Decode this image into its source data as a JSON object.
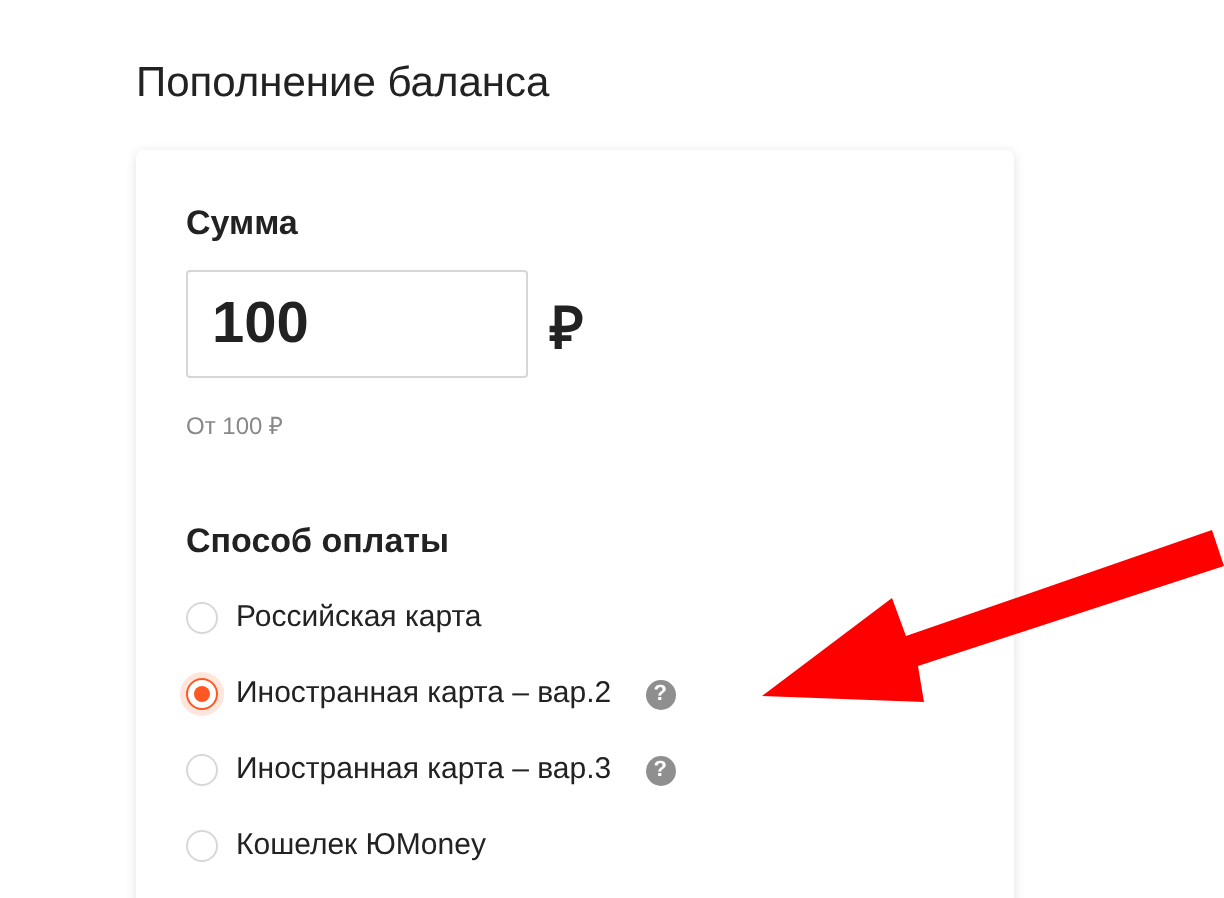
{
  "title": "Пополнение баланса",
  "amount": {
    "label": "Сумма",
    "value": "100",
    "currency": "₽",
    "hint": "От 100 ₽"
  },
  "payment": {
    "label": "Способ оплаты",
    "options": [
      {
        "label": "Российская карта",
        "selected": false
      },
      {
        "label": "Иностранная карта – вар.2",
        "selected": true,
        "help": "?"
      },
      {
        "label": "Иностранная карта – вар.3",
        "selected": false,
        "help": "?"
      },
      {
        "label": "Кошелек ЮMoney",
        "selected": false
      }
    ]
  }
}
